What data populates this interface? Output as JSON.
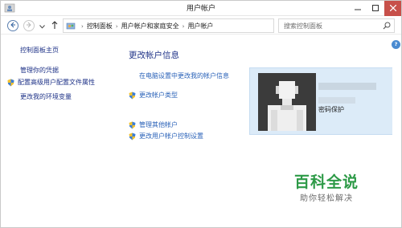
{
  "window": {
    "title": "用户帐户",
    "controls": [
      "minimize-icon",
      "maximize-icon",
      "close-icon"
    ],
    "close_color": "#c7504a"
  },
  "navigation": {
    "back_icon": "back-arrow-icon",
    "forward_icon": "forward-arrow-icon",
    "up_icon": "up-arrow-icon",
    "breadcrumbs": [
      "控制面板",
      "用户帐户和家庭安全",
      "用户帐户"
    ],
    "search_placeholder": "搜索控制面板"
  },
  "left_nav": {
    "items": [
      {
        "label": "控制面板主页",
        "icon": null
      },
      {
        "label": "管理你的凭据",
        "icon": null
      },
      {
        "label": "配置高级用户配置文件属性",
        "icon": "shield-icon"
      },
      {
        "label": "更改我的环境变量",
        "icon": null
      }
    ]
  },
  "main": {
    "title": "更改帐户信息",
    "links": [
      {
        "label": "在电脑设置中更改我的帐户信息",
        "icon": null
      },
      {
        "label": "更改帐户类型",
        "icon": "shield-icon"
      },
      {
        "label": "管理其他帐户",
        "icon": "shield-icon"
      },
      {
        "label": "更改用户帐户控制设置",
        "icon": "shield-icon"
      }
    ]
  },
  "user_panel": {
    "status": "密码保护",
    "panel_color": "#dcebf8"
  },
  "watermark": {
    "title": "百科全说",
    "subtitle": "助你轻松解决",
    "title_color": "#2d9a47"
  },
  "colors": {
    "link": "#2a62b8",
    "nav_link": "#1e3287"
  }
}
